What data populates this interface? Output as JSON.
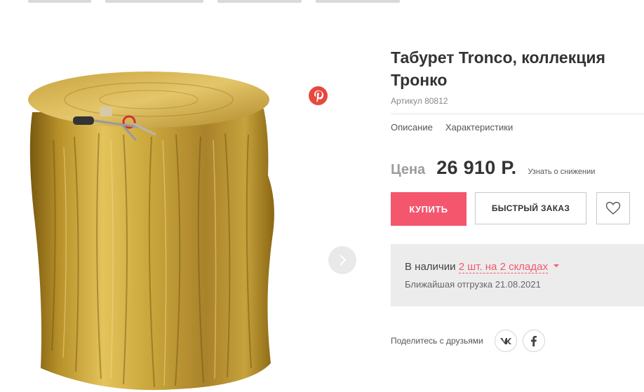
{
  "product": {
    "title": "Табурет Tronco, коллекция Тронко",
    "sku": "Артикул 80812"
  },
  "tabs": [
    {
      "label": "Описание"
    },
    {
      "label": "Характеристики"
    }
  ],
  "price": {
    "label": "Цена",
    "value": "26 910 Р.",
    "alert_link": "Узнать о снижении"
  },
  "actions": {
    "buy_label": "КУПИТЬ",
    "quick_order_label": "БЫСТРЫЙ ЗАКАЗ",
    "favorite_icon": "heart-outline-icon"
  },
  "stock": {
    "prefix": "В наличии",
    "link": "2 шт. на 2 складах",
    "shipping": "Ближайшая отгрузка 21.08.2021"
  },
  "share": {
    "label": "Поделитесь с друзьями",
    "networks": [
      "vk-icon",
      "facebook-icon"
    ]
  },
  "gallery": {
    "pin_icon": "pinterest-icon",
    "next_icon": "chevron-right-icon"
  },
  "colors": {
    "accent": "#f4566e",
    "pinterest": "#e6483e",
    "stock_bg": "#ececec"
  }
}
